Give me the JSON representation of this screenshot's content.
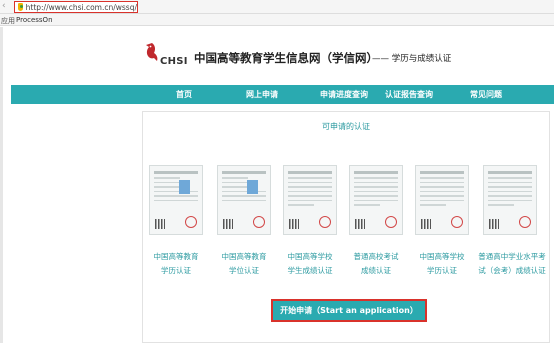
{
  "browser": {
    "url": "http://www.chsi.com.cn/wssq/",
    "apps_label": "应用",
    "bookmark": "ProcessOn"
  },
  "header": {
    "logo_text": "CHSI",
    "title": "中国高等教育学生信息网（学信网）",
    "tagline": "—— 学历与成绩认证"
  },
  "nav": {
    "items": [
      "首页",
      "网上申请",
      "申请进度查询",
      "认证报告查询",
      "常见问题"
    ]
  },
  "panel": {
    "title": "可申请的认证",
    "certs": [
      {
        "line1": "中国高等教育",
        "line2": "学历认证",
        "photo": true
      },
      {
        "line1": "中国高等教育",
        "line2": "学位认证",
        "photo": true
      },
      {
        "line1": "中国高等学校",
        "line2": "学生成绩认证",
        "photo": false
      },
      {
        "line1": "普通高校考试",
        "line2": "成绩认证",
        "photo": false
      },
      {
        "line1": "中国高等学校",
        "line2": "学历认证",
        "photo": false
      },
      {
        "line1": "普通高中学业水平考",
        "line2": "试（会考）成绩认证",
        "photo": false
      }
    ],
    "start_button": "开始申请（Start an application）"
  },
  "colors": {
    "teal": "#2aaab0",
    "highlight_red": "#d9322b",
    "logo_red": "#c0282d"
  }
}
